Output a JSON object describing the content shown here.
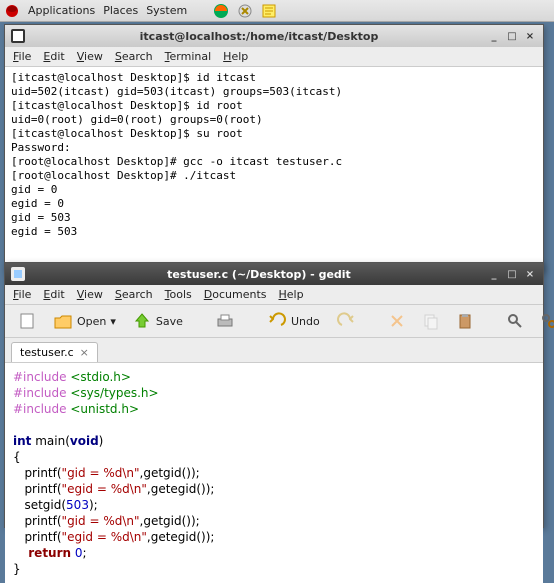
{
  "panel": {
    "menus": [
      "Applications",
      "Places",
      "System"
    ]
  },
  "terminal": {
    "title": "itcast@localhost:/home/itcast/Desktop",
    "menus": [
      "File",
      "Edit",
      "View",
      "Search",
      "Terminal",
      "Help"
    ],
    "lines": "[itcast@localhost Desktop]$ id itcast\nuid=502(itcast) gid=503(itcast) groups=503(itcast)\n[itcast@localhost Desktop]$ id root\nuid=0(root) gid=0(root) groups=0(root)\n[itcast@localhost Desktop]$ su root\nPassword:\n[root@localhost Desktop]# gcc -o itcast testuser.c\n[root@localhost Desktop]# ./itcast\ngid = 0\negid = 0\ngid = 503\negid = 503"
  },
  "gedit": {
    "title": "testuser.c (~/Desktop) - gedit",
    "menus": [
      "File",
      "Edit",
      "View",
      "Search",
      "Tools",
      "Documents",
      "Help"
    ],
    "toolbar": {
      "open": "Open",
      "save": "Save",
      "undo": "Undo"
    },
    "tab": "testuser.c",
    "code": {
      "inc1a": "#include ",
      "inc1b": "<stdio.h>",
      "inc2a": "#include ",
      "inc2b": "<sys/types.h>",
      "inc3a": "#include ",
      "inc3b": "<unistd.h>",
      "int": "int",
      "main": " main(",
      "void": "void",
      "paren": ")",
      "ob": "{",
      "l1a": "   printf(",
      "l1s": "\"gid = %d\\n\"",
      "l1b": ",getgid());",
      "l2a": "   printf(",
      "l2s": "\"egid = %d\\n\"",
      "l2b": ",getegid());",
      "l3a": "   setgid(",
      "l3n": "503",
      "l3b": ");",
      "l4a": "   printf(",
      "l4s": "\"gid = %d\\n\"",
      "l4b": ",getgid());",
      "l5a": "   printf(",
      "l5s": "\"egid = %d\\n\"",
      "l5b": ",getegid());",
      "reta": "    ",
      "retk": "return",
      "retb": " ",
      "retn": "0",
      "retc": ";",
      "cb": "}"
    }
  }
}
